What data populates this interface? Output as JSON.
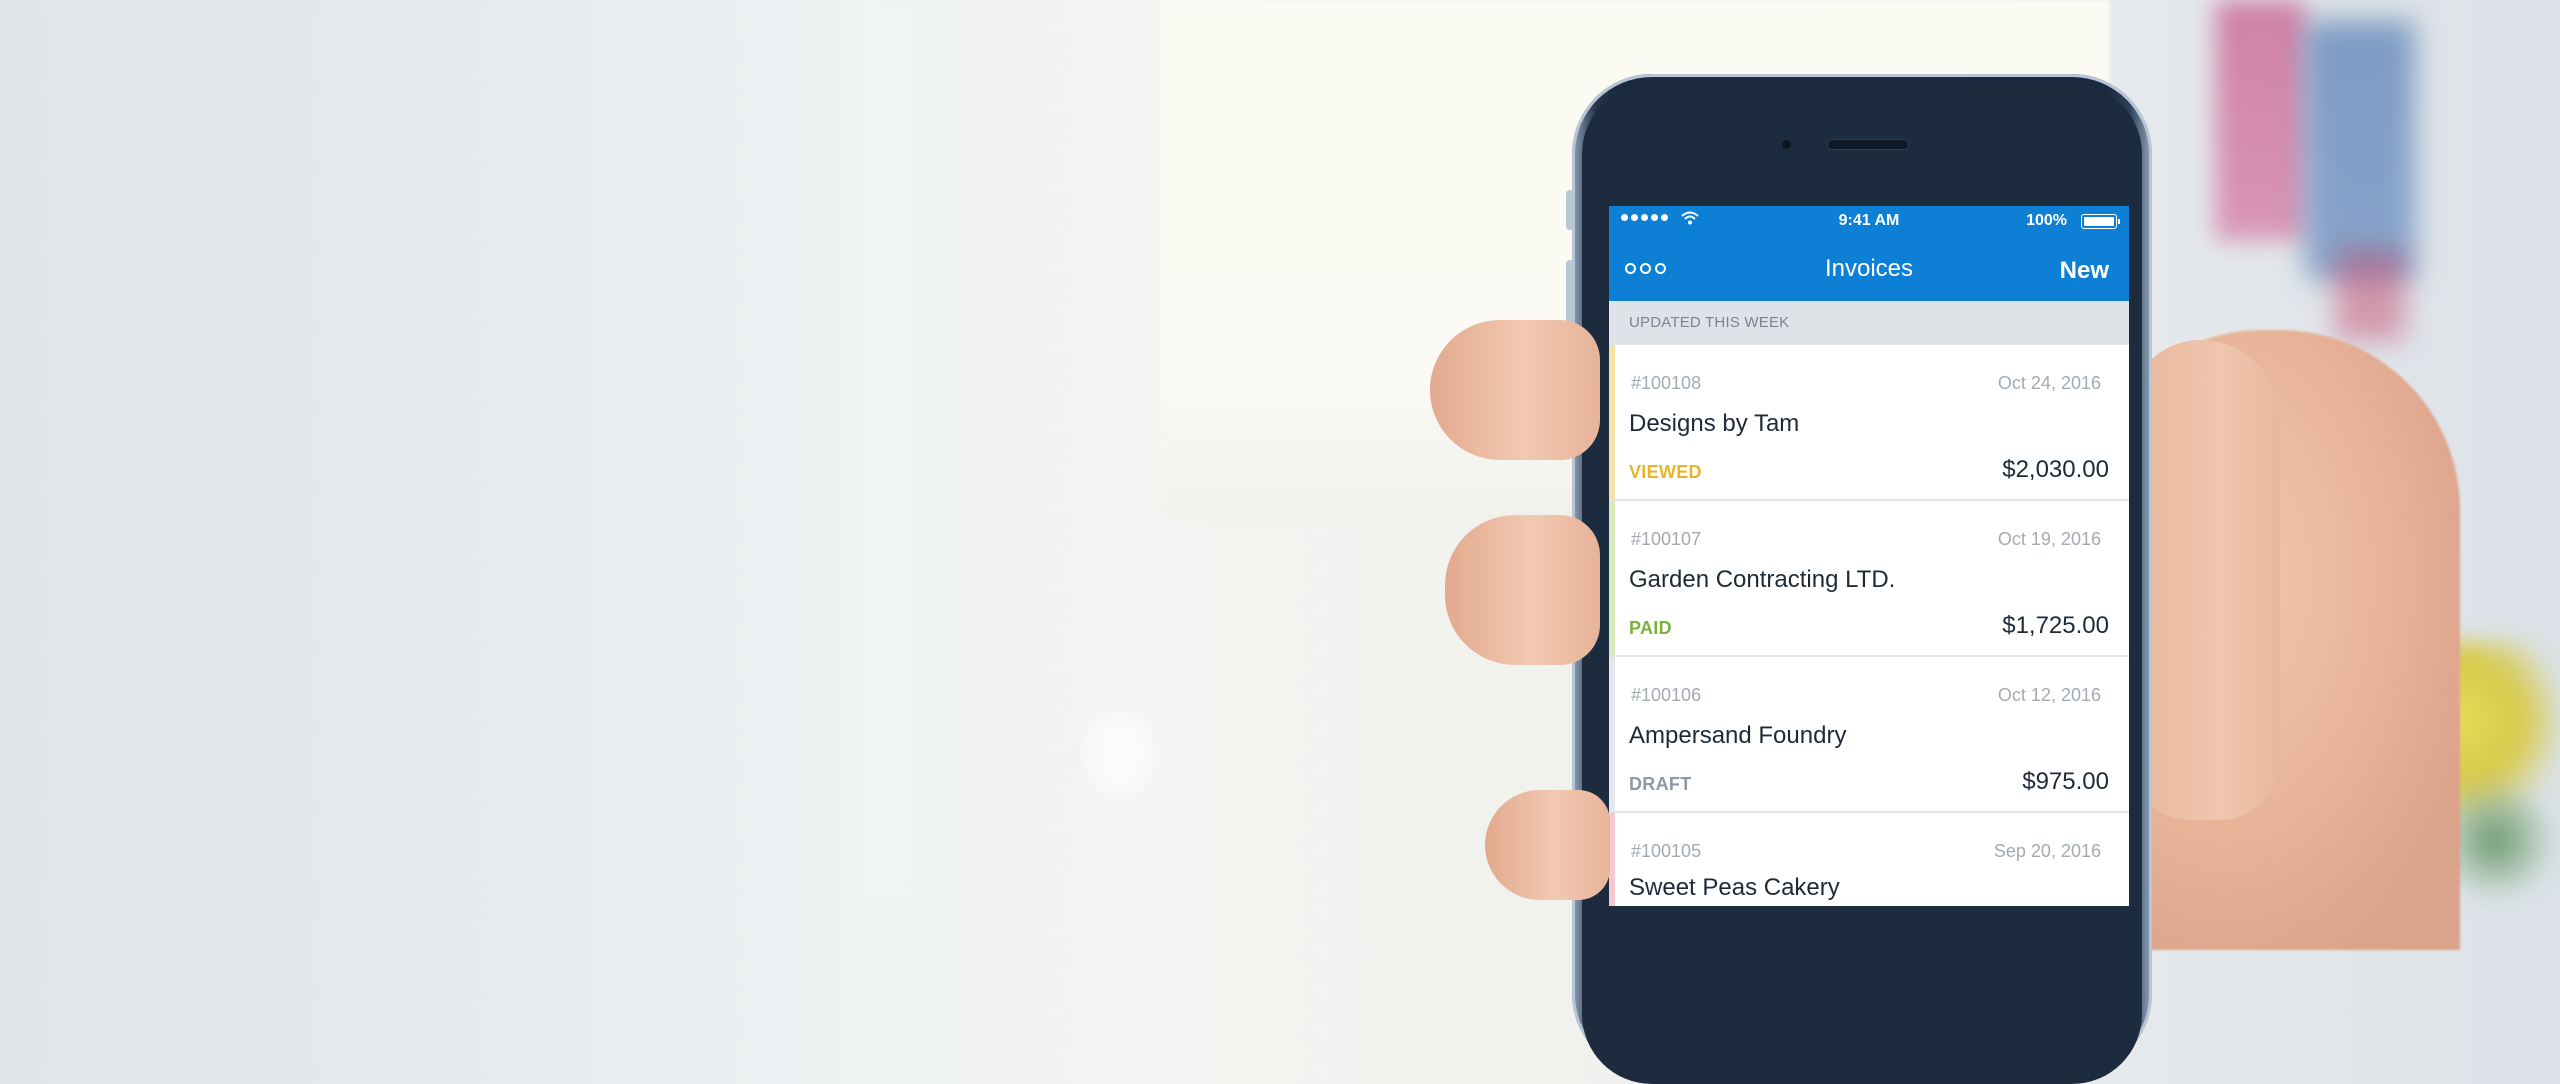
{
  "status_bar": {
    "time": "9:41 AM",
    "battery": "100%"
  },
  "nav": {
    "title": "Invoices",
    "new_label": "New"
  },
  "section_header": "UPDATED THIS WEEK",
  "colors": {
    "brand_blue": "#0d7fd5",
    "viewed": "#e8b52a",
    "paid": "#7bb23a",
    "draft": "#8f98a3",
    "overdue": "#f0a0ae"
  },
  "invoices": [
    {
      "number": "#100108",
      "date": "Oct 24, 2016",
      "client": "Designs by Tam",
      "status": "VIEWED",
      "amount": "$2,030.00"
    },
    {
      "number": "#100107",
      "date": "Oct 19, 2016",
      "client": "Garden Contracting LTD.",
      "status": "PAID",
      "amount": "$1,725.00"
    },
    {
      "number": "#100106",
      "date": "Oct 12, 2016",
      "client": "Ampersand Foundry",
      "status": "DRAFT",
      "amount": "$975.00"
    },
    {
      "number": "#100105",
      "date": "Sep 20, 2016",
      "client": "Sweet Peas Cakery",
      "status": "",
      "amount": ""
    }
  ]
}
